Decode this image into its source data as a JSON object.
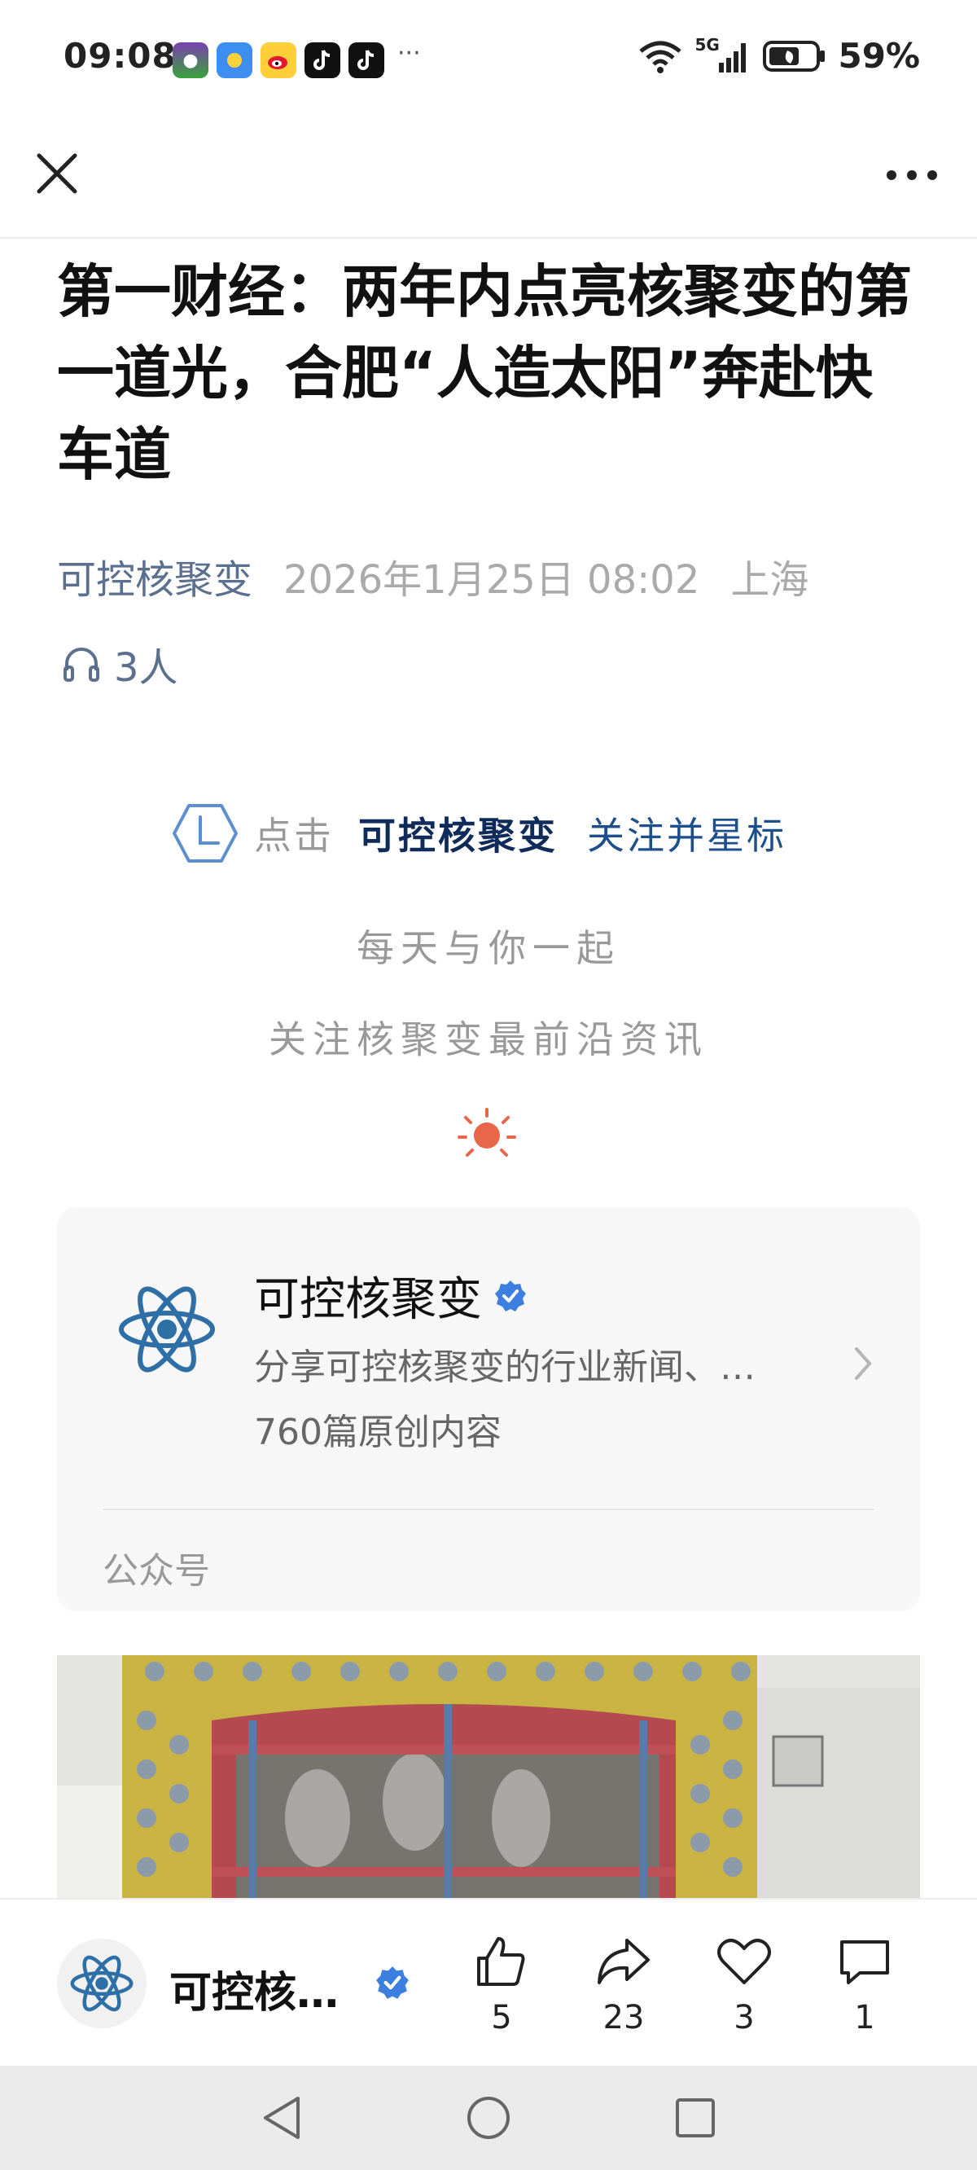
{
  "status_bar": {
    "time": "09:08",
    "overflow": "···",
    "network": "5G",
    "battery_percent": "59%",
    "app_icons": [
      "game-app-icon",
      "weather-app-icon",
      "weibo-app-icon",
      "douyin-app-icon",
      "douyin-app-icon"
    ]
  },
  "nav": {
    "close_icon": "close-icon",
    "menu_icon": "more-horizontal-icon"
  },
  "article": {
    "title": "第一财经：两年内点亮核聚变的第一道光，合肥“人造太阳”奔赴快车道",
    "account": "可控核聚变",
    "date": "2026年1月25日 08:02",
    "location": "上海",
    "listeners": "3人"
  },
  "follow_banner": {
    "prefix": "点击",
    "account": "可控核聚变",
    "action": "关注并星标"
  },
  "intro": {
    "line1": "每天与你一起",
    "line2": "关注核聚变最前沿资讯"
  },
  "account_card": {
    "name": "可控核聚变",
    "description": "分享可控核聚变的行业新闻、…",
    "count": "760篇原创内容",
    "type": "公众号"
  },
  "action_bar": {
    "account_name": "可控核…",
    "like_count": "5",
    "share_count": "23",
    "favorite_count": "3",
    "comment_count": "1"
  },
  "colors": {
    "accent": "#1e4f8d",
    "meta_blue": "#5b6f8f",
    "verified": "#3d7fe0",
    "sun": "#e8674a"
  }
}
